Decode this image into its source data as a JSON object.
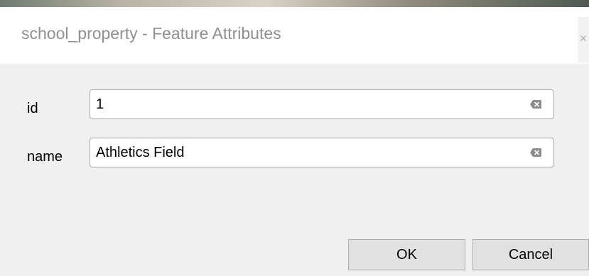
{
  "dialog": {
    "title": "school_property - Feature Attributes"
  },
  "fields": [
    {
      "label": "id",
      "value": "1"
    },
    {
      "label": "name",
      "value": "Athletics Field"
    }
  ],
  "buttons": {
    "ok_label": "OK",
    "cancel_label": "Cancel"
  },
  "icons": {
    "close": "close-icon",
    "clear": "clear-field-icon"
  },
  "colors": {
    "dialog_background": "#f0f0f0",
    "title_text": "#8f8f8f",
    "button_background": "#e1e1e1",
    "field_border": "#a9a9a9"
  }
}
